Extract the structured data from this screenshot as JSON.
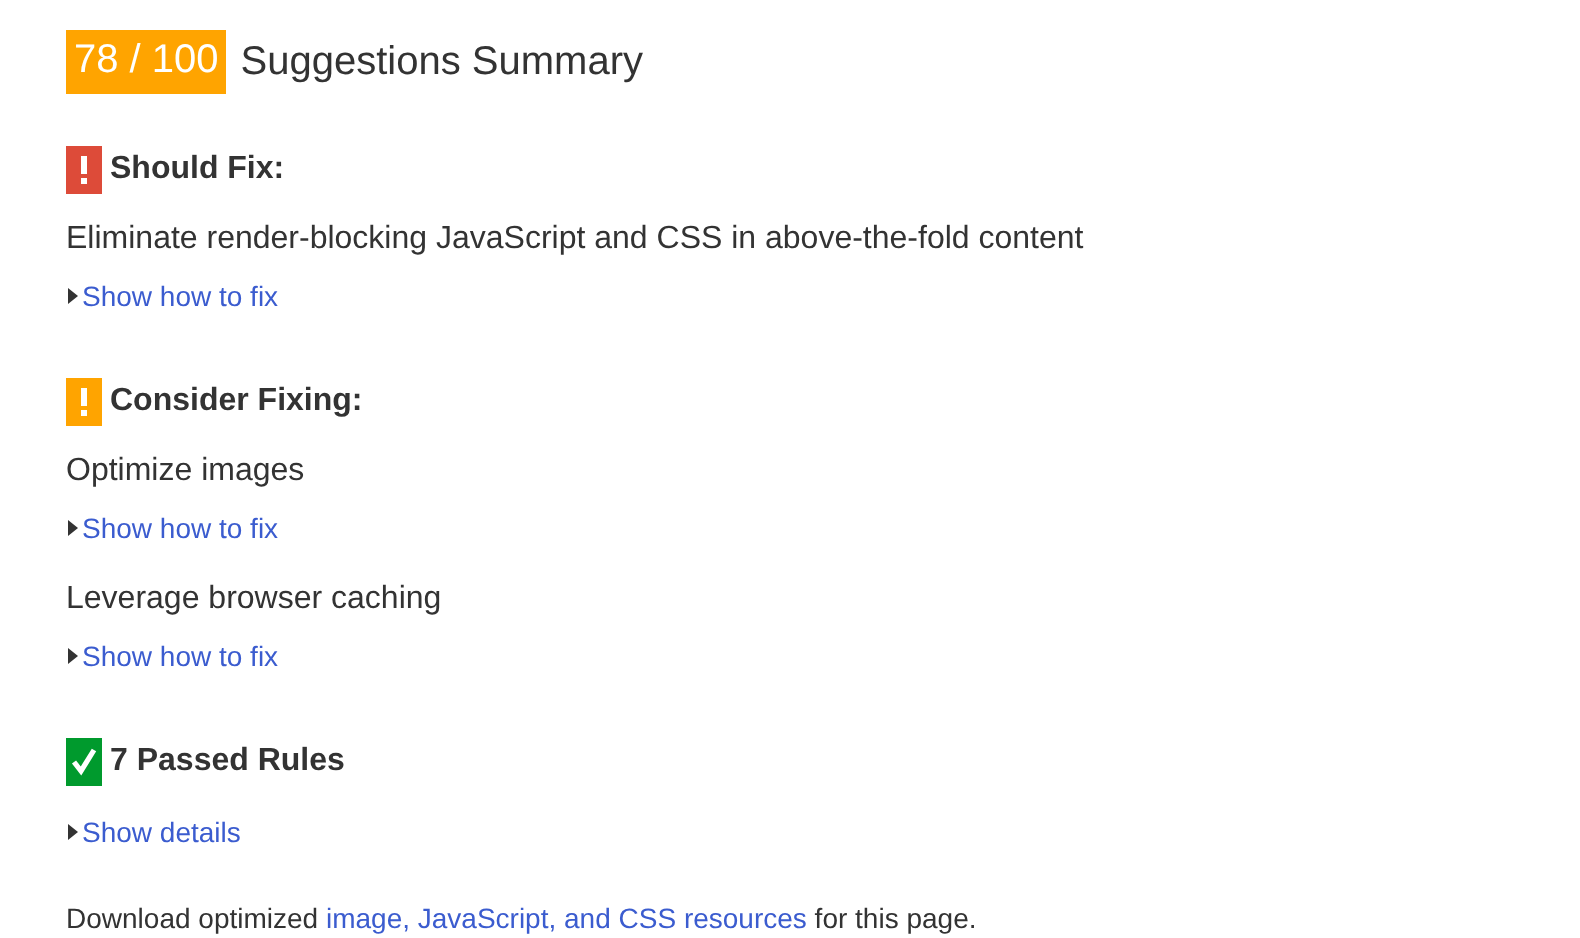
{
  "score": {
    "text": "78 / 100",
    "title": "Suggestions Summary"
  },
  "sections": [
    {
      "kind": "fix",
      "heading": "Should Fix:",
      "rules": [
        {
          "title": "Eliminate render-blocking JavaScript and CSS in above-the-fold content",
          "link": "Show how to fix",
          "expanded": false
        }
      ]
    },
    {
      "kind": "consider",
      "heading": "Consider Fixing:",
      "rules": [
        {
          "title": "Optimize images",
          "link": "Show how to fix",
          "expanded": false
        },
        {
          "title": "Leverage browser caching",
          "link": "Show how to fix",
          "expanded": false
        }
      ]
    },
    {
      "kind": "passed",
      "heading": "7 Passed Rules",
      "rules": [
        {
          "link": "Show details",
          "expanded": false
        }
      ]
    }
  ],
  "footer": {
    "before": "Download optimized ",
    "link": "image, JavaScript, and CSS resources",
    "after": " for this page."
  }
}
